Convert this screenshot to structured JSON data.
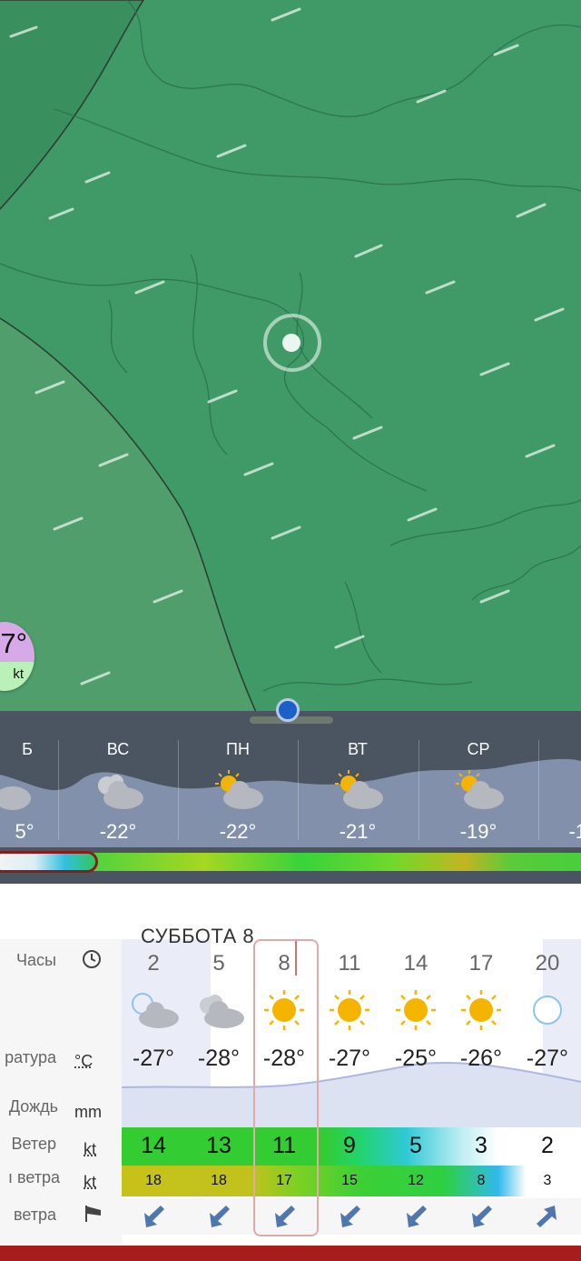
{
  "map": {
    "location_marker": "location-marker-icon",
    "overlay_temp": "7°",
    "overlay_unit": "kt",
    "colors": {
      "map_green": "#3f9a67",
      "region_green": "#4f9e6c"
    }
  },
  "forecast_days": [
    {
      "name": "Б",
      "temp": "5°",
      "icon": "partly-cloudy-icon"
    },
    {
      "name": "ВС",
      "temp": "-22°",
      "icon": "partly-cloudy-icon"
    },
    {
      "name": "ПН",
      "temp": "-22°",
      "icon": "sun-cloud-icon"
    },
    {
      "name": "ВТ",
      "temp": "-21°",
      "icon": "sun-cloud-icon"
    },
    {
      "name": "СР",
      "temp": "-19°",
      "icon": "sun-cloud-icon"
    },
    {
      "name": "",
      "temp": "-1",
      "icon": "sun-icon"
    }
  ],
  "detail": {
    "day_title": "СУББОТА 8",
    "labels": {
      "hours": "Часы",
      "temperature": "ратура",
      "rain": "Дождь",
      "wind": "Ветер",
      "gusts": "ı ветра",
      "direction": "ветра"
    },
    "units": {
      "temp": "°C",
      "rain": "mm",
      "wind": "kt",
      "gusts": "kt"
    },
    "hours": [
      "2",
      "5",
      "8",
      "11",
      "14",
      "17",
      "20"
    ],
    "icons": [
      "moon-cloud-icon",
      "cloud-icon",
      "sun-icon",
      "sun-icon",
      "sun-icon",
      "sun-icon",
      "moon-icon"
    ],
    "temps": [
      "-27°",
      "-28°",
      "-28°",
      "-27°",
      "-25°",
      "-26°",
      "-27°"
    ],
    "wind": [
      "14",
      "13",
      "11",
      "9",
      "5",
      "3",
      "2"
    ],
    "gusts": [
      "18",
      "18",
      "17",
      "15",
      "12",
      "8",
      "3"
    ],
    "wind_dir": [
      "arrow-sw-icon",
      "arrow-sw-icon",
      "arrow-sw-icon",
      "arrow-sw-icon",
      "arrow-sw-icon",
      "arrow-sw-icon",
      "arrow-ne-icon"
    ],
    "selected_hour": "8"
  }
}
